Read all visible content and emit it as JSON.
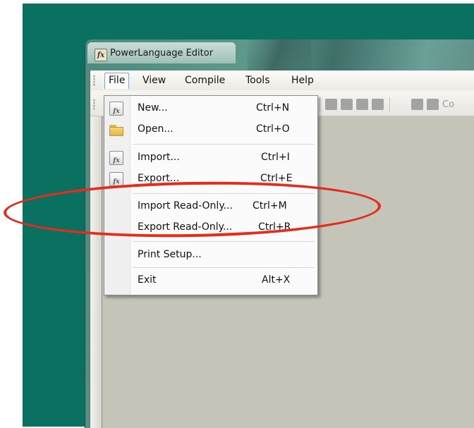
{
  "window": {
    "title": "PowerLanguage Editor",
    "app_icon_glyph": "fx"
  },
  "menubar": {
    "items": [
      {
        "id": "file",
        "label": "File"
      },
      {
        "id": "view",
        "label": "View"
      },
      {
        "id": "compile",
        "label": "Compile"
      },
      {
        "id": "tools",
        "label": "Tools"
      },
      {
        "id": "help",
        "label": "Help"
      }
    ]
  },
  "toolbar": {
    "partial_label": "Co"
  },
  "file_menu": {
    "items": [
      {
        "label": "New...",
        "shortcut": "Ctrl+N",
        "icon": "new-study-icon"
      },
      {
        "label": "Open...",
        "shortcut": "Ctrl+O",
        "icon": "folder-icon"
      },
      {
        "label": "Import...",
        "shortcut": "Ctrl+I",
        "icon": "import-icon"
      },
      {
        "label": "Export...",
        "shortcut": "Ctrl+E",
        "icon": "export-icon"
      },
      {
        "label": "Import Read-Only...",
        "shortcut": "Ctrl+M"
      },
      {
        "label": "Export Read-Only...",
        "shortcut": "Ctrl+R"
      },
      {
        "label": "Print Setup...",
        "shortcut": ""
      },
      {
        "label": "Exit",
        "shortcut": "Alt+X"
      }
    ]
  },
  "colors": {
    "desktop": "#0a7160",
    "highlight_ellipse": "#e42b1c",
    "editor_background": "#c5c4b8"
  }
}
